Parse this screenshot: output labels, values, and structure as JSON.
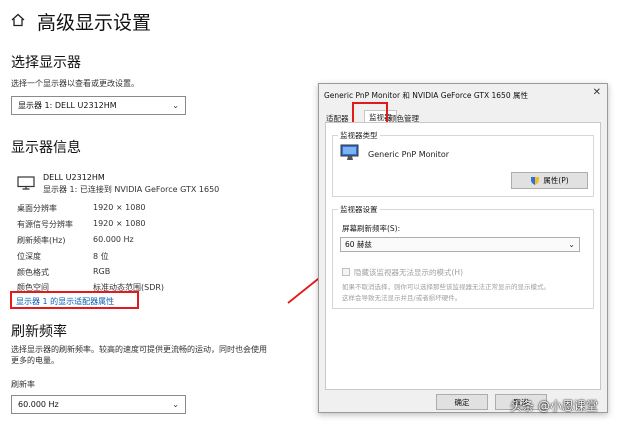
{
  "settings": {
    "title": "高级显示设置",
    "select_display": {
      "heading": "选择显示器",
      "instruction": "选择一个显示器以查看或更改设置。",
      "dropdown_value": "显示器 1: DELL U2312HM"
    },
    "display_info": {
      "heading": "显示器信息",
      "monitor_name": "DELL U2312HM",
      "monitor_connection": "显示器 1: 已连接到 NVIDIA GeForce GTX 1650",
      "rows": [
        {
          "label": "桌面分辨率",
          "value": "1920 × 1080"
        },
        {
          "label": "有源信号分辨率",
          "value": "1920 × 1080"
        },
        {
          "label": "刷新频率(Hz)",
          "value": "60.000 Hz"
        },
        {
          "label": "位深度",
          "value": "8 位"
        },
        {
          "label": "颜色格式",
          "value": "RGB"
        },
        {
          "label": "颜色空间",
          "value": "标准动态范围(SDR)"
        }
      ],
      "adapter_link": "显示器 1 的显示适配器属性"
    },
    "refresh": {
      "heading": "刷新频率",
      "description_line1": "选择显示器的刷新频率。较高的速度可提供更流畅的运动，同时也会使用",
      "description_line2": "更多的电量。",
      "field_label": "刷新率",
      "dropdown_value": "60.000 Hz"
    }
  },
  "dialog": {
    "title": "Generic PnP Monitor 和 NVIDIA GeForce GTX 1650 属性",
    "close_glyph": "✕",
    "tabs": [
      {
        "label": "适配器"
      },
      {
        "label": "监视器"
      },
      {
        "label": "颜色管理"
      }
    ],
    "monitor_type_label": "监视器类型",
    "monitor_type_name": "Generic PnP Monitor",
    "properties_button": "属性(P)",
    "monitor_settings_label": "监视器设置",
    "refresh_label": "屏幕刷新频率(S):",
    "refresh_value": "60 赫兹",
    "hide_modes_checkbox": "隐藏该监视器无法显示的模式(H)",
    "warning_line1": "如果不取消选择，则你可以选择那些该监视器无法正常显示的显示模式。",
    "warning_line2": "这样会导致无法显示并且/或者损坏硬件。",
    "ok_button": "确定",
    "cancel_button": "取消"
  },
  "watermark": "头条 @小恩课堂",
  "colors": {
    "highlight_red": "#e11b1b",
    "link_blue": "#0a5fb4"
  },
  "icons": {
    "home": "home-icon",
    "monitor": "monitor-icon",
    "shield": "shield-icon",
    "chevron": "chevron-down-icon"
  }
}
